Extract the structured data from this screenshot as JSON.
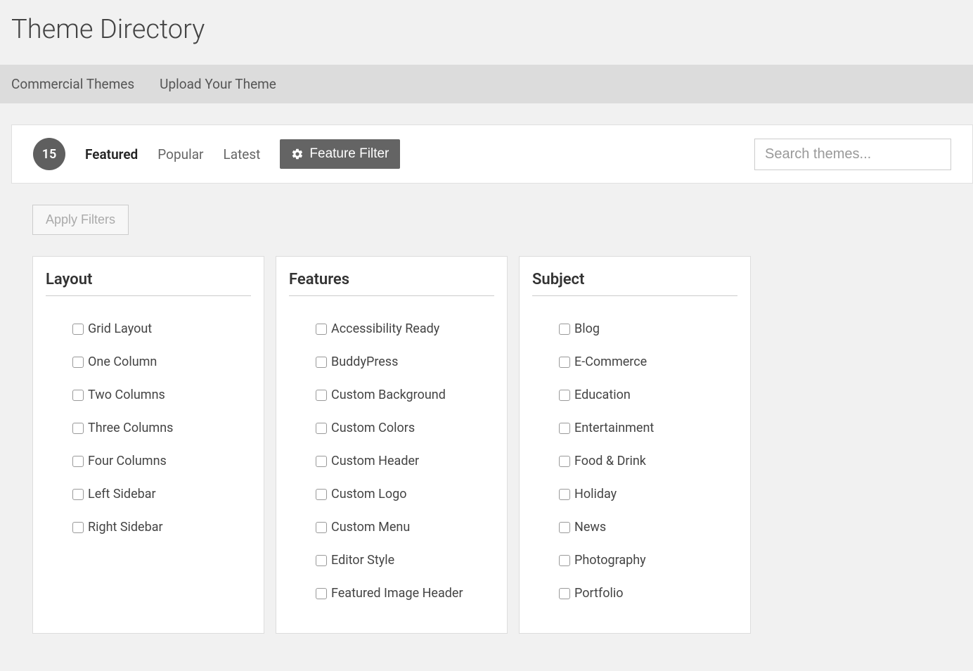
{
  "page": {
    "title": "Theme Directory"
  },
  "nav": {
    "commercial": "Commercial Themes",
    "upload": "Upload Your Theme"
  },
  "toolbar": {
    "count": "15",
    "tabs": {
      "featured": "Featured",
      "popular": "Popular",
      "latest": "Latest"
    },
    "feature_filter": "Feature Filter",
    "search_placeholder": "Search themes..."
  },
  "filters": {
    "apply_label": "Apply Filters",
    "layout": {
      "heading": "Layout",
      "items": [
        "Grid Layout",
        "One Column",
        "Two Columns",
        "Three Columns",
        "Four Columns",
        "Left Sidebar",
        "Right Sidebar"
      ]
    },
    "features": {
      "heading": "Features",
      "items": [
        "Accessibility Ready",
        "BuddyPress",
        "Custom Background",
        "Custom Colors",
        "Custom Header",
        "Custom Logo",
        "Custom Menu",
        "Editor Style",
        "Featured Image Header"
      ]
    },
    "subject": {
      "heading": "Subject",
      "items": [
        "Blog",
        "E-Commerce",
        "Education",
        "Entertainment",
        "Food & Drink",
        "Holiday",
        "News",
        "Photography",
        "Portfolio"
      ]
    }
  }
}
